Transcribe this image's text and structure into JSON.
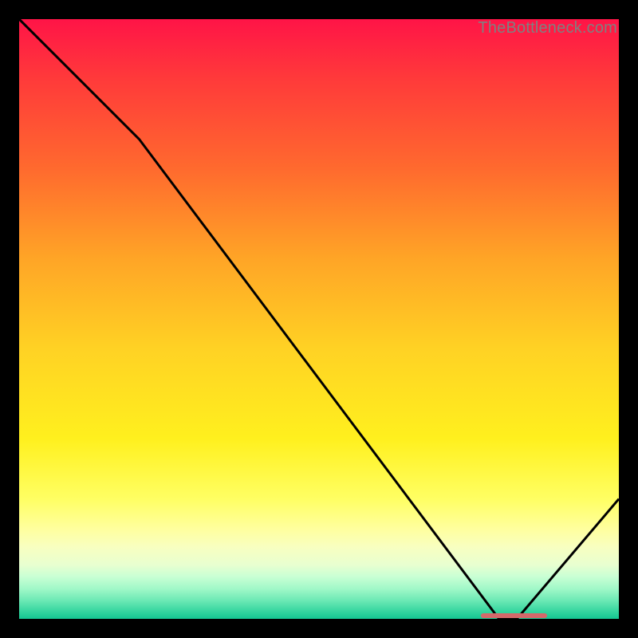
{
  "watermark": "TheBottleneck.com",
  "chart_data": {
    "type": "line",
    "title": "",
    "xlabel": "",
    "ylabel": "",
    "xlim": [
      0,
      100
    ],
    "ylim": [
      0,
      100
    ],
    "grid": false,
    "legend": "none",
    "x": [
      0,
      20,
      80,
      83,
      100
    ],
    "values": [
      100,
      80,
      0,
      0,
      20
    ],
    "min_marker": {
      "x_start": 77,
      "x_end": 88,
      "y": 0.5
    },
    "colors": {
      "curve": "#000000",
      "marker": "#d4686a",
      "gradient_top": "#ff1447",
      "gradient_bottom": "#14c592"
    }
  }
}
